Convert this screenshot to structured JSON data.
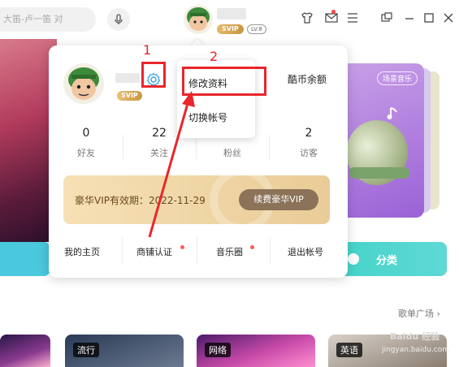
{
  "topbar": {
    "search_placeholder": "大笛-卢一笛 对",
    "level": "LV.8",
    "svip": "SVIP"
  },
  "panel": {
    "svip": "SVIP",
    "coin_label": "酷币余额",
    "stats": [
      {
        "value": "0",
        "label": "好友"
      },
      {
        "value": "22",
        "label": "关注"
      },
      {
        "value": "",
        "label": "粉丝"
      },
      {
        "value": "2",
        "label": "访客"
      }
    ],
    "vip_expiry": "豪华VIP有效期：2022-11-29",
    "vip_renew": "续费豪华VIP",
    "links": [
      "我的主页",
      "商铺认证",
      "音乐圈",
      "退出帐号"
    ]
  },
  "menu": {
    "items": [
      "修改资料",
      "切换帐号"
    ]
  },
  "annotations": {
    "one": "1",
    "two": "2"
  },
  "background": {
    "scene_tag": "场景音乐",
    "classify": "分类",
    "playlist_link": "歌单广场 ›",
    "thumb_tags": [
      "流行",
      "网络",
      "英语"
    ],
    "watermark": "Baidu 经验",
    "watermark_sub": "jingyan.baidu.com"
  },
  "colors": {
    "annotation_red": "#e8262b",
    "vip_gold": "#e9cc97",
    "accent_teal": "#43d3c7"
  }
}
